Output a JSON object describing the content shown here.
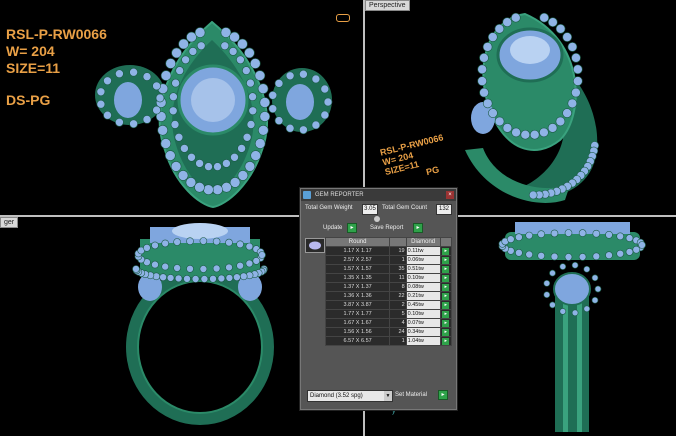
{
  "viewports": {
    "top_left": {
      "label": ""
    },
    "top_right": {
      "label": "Perspective"
    },
    "bottom_left": {
      "label": ""
    },
    "bottom_right": {
      "label": ""
    }
  },
  "overlay": {
    "line1": "RSL-P-RW0066",
    "line2": "W= 204",
    "line3": "SIZE=11",
    "line4": "DS-PG"
  },
  "overlay_small": {
    "line1": "RSL-P-RW0066",
    "line2": "W= 204",
    "line3": "SIZE=11",
    "line4": "PG"
  },
  "axis_label": "y",
  "gem_reporter": {
    "title": "GEM REPORTER",
    "total_weight_label": "Total Gem Weight",
    "total_weight_value": "3.05",
    "total_count_label": "Total Gem Count",
    "total_count_value": "132",
    "update_label": "Update",
    "save_label": "Save Report",
    "columns": [
      "Round",
      "",
      "Diamond",
      ""
    ],
    "rows": [
      {
        "size": "1.17 X 1.17",
        "count": "19",
        "weight": "0.11tw"
      },
      {
        "size": "2.57 X 2.57",
        "count": "1",
        "weight": "0.06tw"
      },
      {
        "size": "1.57 X 1.57",
        "count": "35",
        "weight": "0.51tw"
      },
      {
        "size": "1.35 X 1.35",
        "count": "11",
        "weight": "0.10tw"
      },
      {
        "size": "1.37 X 1.37",
        "count": "8",
        "weight": "0.08tw"
      },
      {
        "size": "1.36 X 1.36",
        "count": "22",
        "weight": "0.21tw"
      },
      {
        "size": "3.87 X 3.87",
        "count": "2",
        "weight": "0.45tw"
      },
      {
        "size": "1.77 X 1.77",
        "count": "5",
        "weight": "0.10tw"
      },
      {
        "size": "1.67 X 1.67",
        "count": "4",
        "weight": "0.07tw"
      },
      {
        "size": "1.56 X 1.56",
        "count": "24",
        "weight": "0.34tw"
      },
      {
        "size": "6.57 X 6.57",
        "count": "1",
        "weight": "1.04tw"
      }
    ],
    "material_select": "Diamond   (3.52 spg)",
    "set_material_label": "Set Material"
  },
  "colors": {
    "metal": "#1f6e55",
    "metal_light": "#3aa27e",
    "gem": "#7fa6de",
    "gem_light": "#b9d2f2",
    "overlay_text": "#e9a046",
    "panel_bg": "#555555"
  },
  "icons": {
    "logo": "gem-reporter-logo-icon",
    "close": "close-icon",
    "go": "green-arrow-icon"
  }
}
